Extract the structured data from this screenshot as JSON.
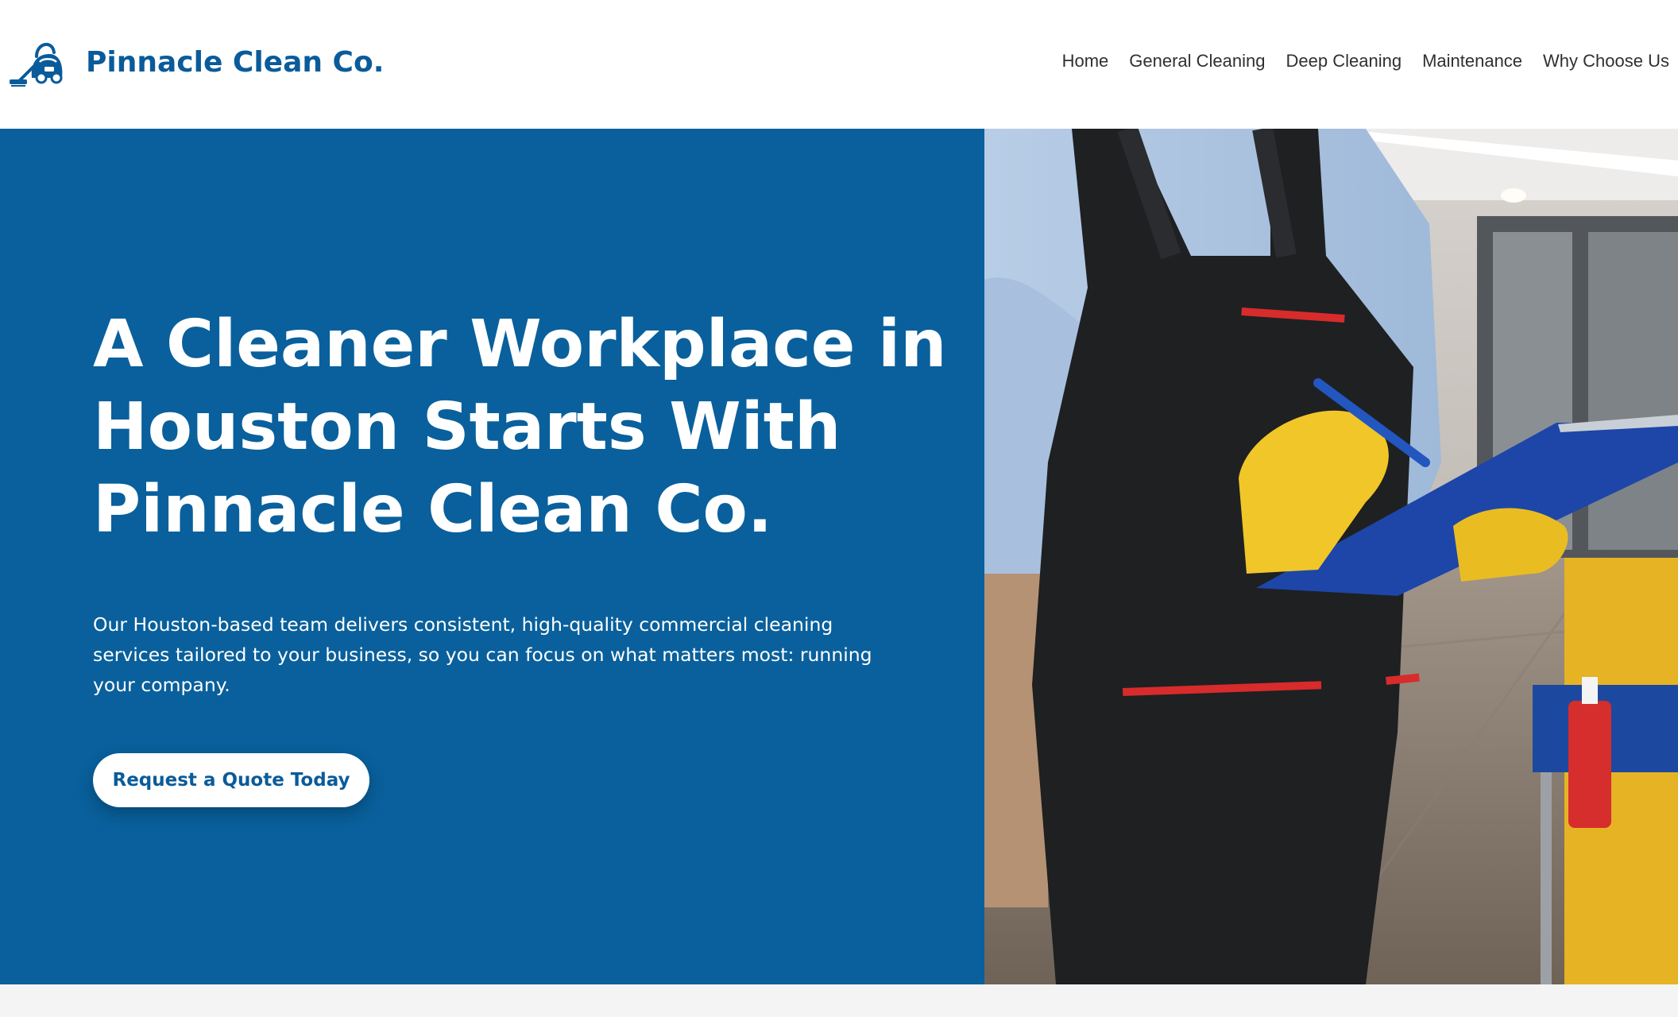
{
  "header": {
    "brand": "Pinnacle Clean Co.",
    "logo_icon": "vacuum-cleaner-icon",
    "nav": [
      "Home",
      "General Cleaning",
      "Deep Cleaning",
      "Maintenance",
      "Why Choose Us"
    ]
  },
  "hero": {
    "title": "A Cleaner Workplace in Houston Starts With Pinnacle Clean Co.",
    "text": "Our Houston-based team delivers consistent, high-quality commercial cleaning services tailored to your business, so you can focus on what matters most: running your company.",
    "cta": "Request a Quote Today"
  },
  "colors": {
    "brand_blue": "#09609c",
    "button_bg": "#ffffff",
    "page_bg": "#f4f4f4"
  }
}
